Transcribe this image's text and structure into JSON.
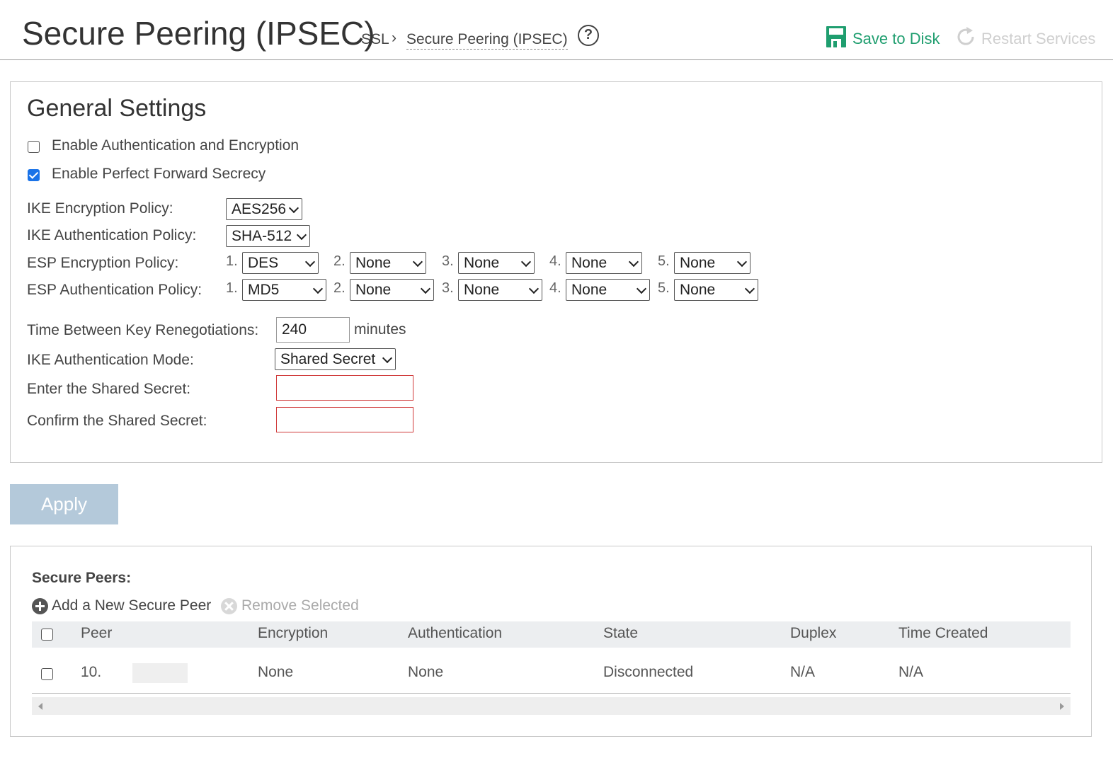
{
  "header": {
    "title": "Secure Peering (IPSEC)",
    "breadcrumb_root": "SSL",
    "breadcrumb_sep": "›",
    "breadcrumb_current": "Secure Peering (IPSEC)",
    "help_symbol": "?",
    "save_label": "Save to Disk",
    "restart_label": "Restart Services",
    "save_color": "#1f9e6f",
    "restart_color": "#cfcfcf"
  },
  "general": {
    "title": "General Settings",
    "enable_auth_enc": {
      "label": "Enable Authentication and Encryption",
      "checked": false
    },
    "enable_pfs": {
      "label": "Enable Perfect Forward Secrecy",
      "checked": true
    },
    "ike_enc_label": "IKE Encryption Policy:",
    "ike_enc_value": "AES256",
    "ike_auth_label": "IKE Authentication Policy:",
    "ike_auth_value": "SHA-512",
    "esp_enc_label": "ESP Encryption Policy:",
    "esp_enc": [
      {
        "num": "1.",
        "value": "DES"
      },
      {
        "num": "2.",
        "value": "None"
      },
      {
        "num": "3.",
        "value": "None"
      },
      {
        "num": "4.",
        "value": "None"
      },
      {
        "num": "5.",
        "value": "None"
      }
    ],
    "esp_auth_label": "ESP Authentication Policy:",
    "esp_auth": [
      {
        "num": "1.",
        "value": "MD5"
      },
      {
        "num": "2.",
        "value": "None"
      },
      {
        "num": "3.",
        "value": "None"
      },
      {
        "num": "4.",
        "value": "None"
      },
      {
        "num": "5.",
        "value": "None"
      }
    ],
    "renegotiation_label": "Time Between Key Renegotiations:",
    "renegotiation_value": "240",
    "renegotiation_unit": "minutes",
    "ike_mode_label": "IKE Authentication Mode:",
    "ike_mode_value": "Shared Secret",
    "shared_secret_label": "Enter the Shared Secret:",
    "shared_secret_value": "",
    "confirm_secret_label": "Confirm the Shared Secret:",
    "confirm_secret_value": ""
  },
  "apply_label": "Apply",
  "peers": {
    "title": "Secure Peers:",
    "add_label": "Add a New Secure Peer",
    "remove_label": "Remove Selected",
    "columns": [
      "Peer",
      "Encryption",
      "Authentication",
      "State",
      "Duplex",
      "Time Created"
    ],
    "rows": [
      {
        "peer": "10.",
        "encryption": "None",
        "authentication": "None",
        "state": "Disconnected",
        "duplex": "N/A",
        "time_created": "N/A"
      }
    ]
  }
}
